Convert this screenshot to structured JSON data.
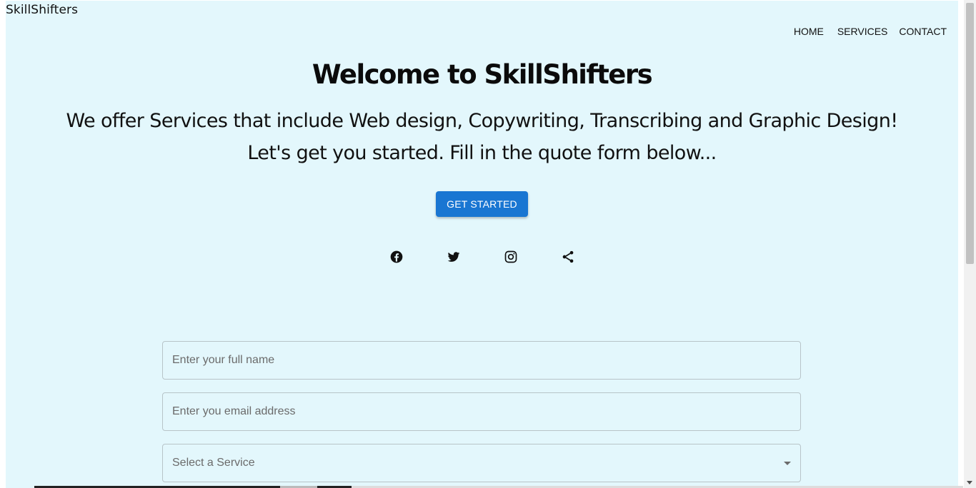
{
  "header": {
    "brand": "SkillShifters",
    "nav": [
      "HOME",
      "SERVICES",
      "CONTACT"
    ]
  },
  "hero": {
    "title": "Welcome to SkillShifters",
    "subtitle_line1": "We offer Services that include Web design, Copywriting, Transcribing and Graphic Design!",
    "subtitle_line2": "Let's get you started. Fill in the quote form below...",
    "cta_label": "GET STARTED"
  },
  "socials": [
    {
      "icon": "facebook-icon"
    },
    {
      "icon": "twitter-icon"
    },
    {
      "icon": "instagram-icon"
    },
    {
      "icon": "share-icon"
    }
  ],
  "form": {
    "name_placeholder": "Enter your full name",
    "email_placeholder": "Enter you email address",
    "service_placeholder": "Select a Service"
  },
  "colors": {
    "page_background": "#e3f7fc",
    "button": "#1976d2"
  }
}
